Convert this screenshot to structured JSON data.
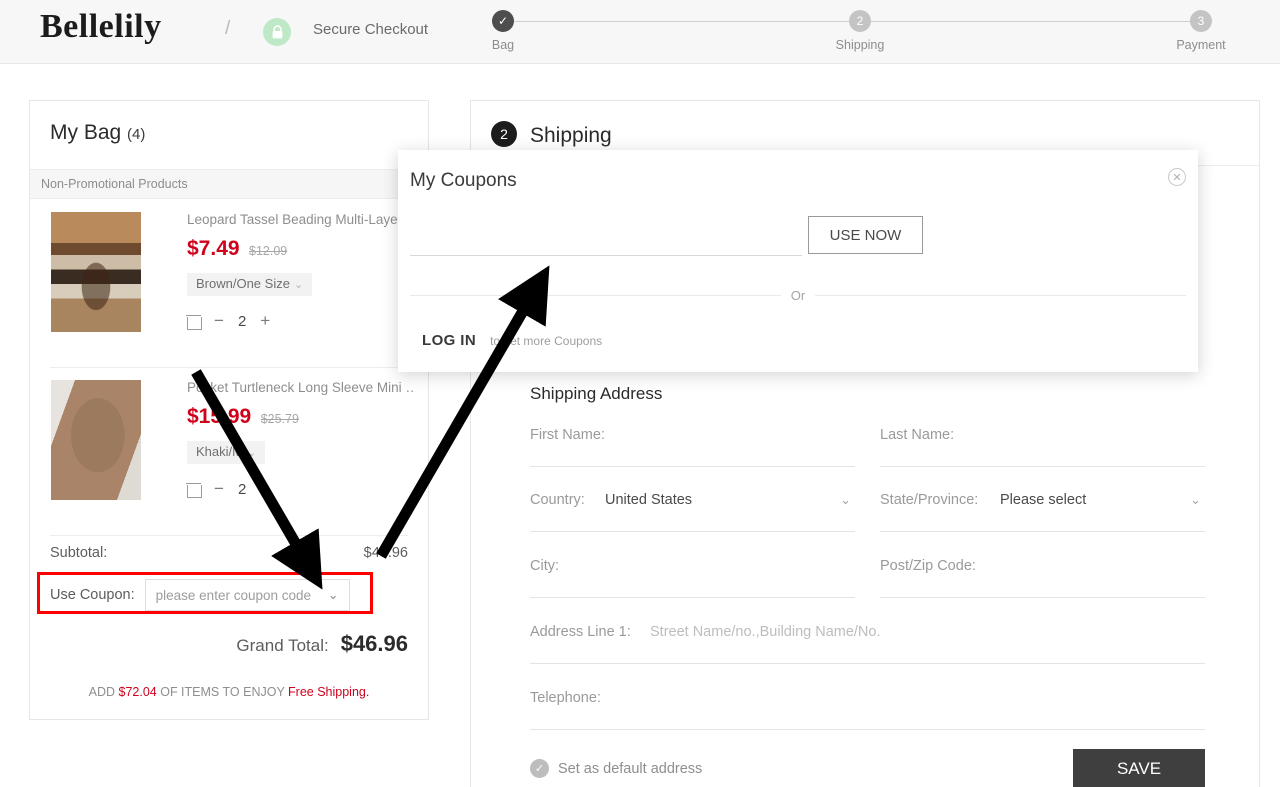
{
  "header": {
    "brand": "Bellelily",
    "separator": "/",
    "lock_icon": "lock-icon",
    "secure_text": "Secure Checkout",
    "steps": [
      {
        "id": "bag",
        "marker": "✓",
        "label": "Bag",
        "state": "done"
      },
      {
        "id": "shipping",
        "marker": "2",
        "label": "Shipping",
        "state": "todo"
      },
      {
        "id": "payment",
        "marker": "3",
        "label": "Payment",
        "state": "todo"
      }
    ]
  },
  "cart": {
    "title": "My Bag",
    "count": "(4)",
    "section_label": "Non-Promotional Products",
    "items": [
      {
        "name": "Leopard Tassel Beading Multi-Layer…",
        "price": "$7.49",
        "original_price": "$12.09",
        "variant": "Brown/One Size",
        "quantity": "2",
        "minus": "−",
        "plus": "+"
      },
      {
        "name": "Pocket Turtleneck Long Sleeve Mini …",
        "price": "$15.99",
        "original_price": "$25.79",
        "variant": "Khaki/M",
        "quantity": "2",
        "minus": "−",
        "plus": "+"
      }
    ],
    "subtotal_label": "Subtotal:",
    "subtotal_value": "$48.96",
    "coupon_label": "Use Coupon:",
    "coupon_placeholder": "please enter coupon code",
    "grand_total_label": "Grand Total:",
    "grand_total_value": "$46.96",
    "free_shipping_prefix": "ADD ",
    "free_shipping_amount": "$72.04",
    "free_shipping_middle": " OF ITEMS TO ENJOY ",
    "free_shipping_suffix": "Free Shipping."
  },
  "shipping": {
    "step_number": "2",
    "step_title": "Shipping",
    "address_title": "Shipping Address",
    "fields": [
      {
        "label": "First Name:",
        "value": "",
        "placeholder": "",
        "type": "text"
      },
      {
        "label": "Last Name:",
        "value": "",
        "placeholder": "",
        "type": "text"
      },
      {
        "label": "Country:",
        "value": "United States",
        "placeholder": "",
        "type": "select"
      },
      {
        "label": "State/Province:",
        "value": "Please select",
        "placeholder": "",
        "type": "select"
      },
      {
        "label": "City:",
        "value": "",
        "placeholder": "",
        "type": "text"
      },
      {
        "label": "Post/Zip Code:",
        "value": "",
        "placeholder": "",
        "type": "text"
      },
      {
        "label": "Address Line 1:",
        "value": "",
        "placeholder": "Street Name/no.,Building Name/No.",
        "type": "text"
      },
      {
        "label": "Telephone:",
        "value": "",
        "placeholder": "",
        "type": "text"
      }
    ],
    "default_address_label": "Set as default address",
    "default_address_checked": true,
    "save_label": "SAVE"
  },
  "coupon_modal": {
    "title": "My Coupons",
    "close_icon": "close-icon",
    "input_value": "",
    "input_placeholder": "",
    "use_now_label": "USE NOW",
    "or_label": "Or",
    "login_label": "LOG IN",
    "login_text": "to get more Coupons"
  },
  "annotations": {
    "highlight_color": "#ff0000",
    "arrow_color": "#000000"
  }
}
